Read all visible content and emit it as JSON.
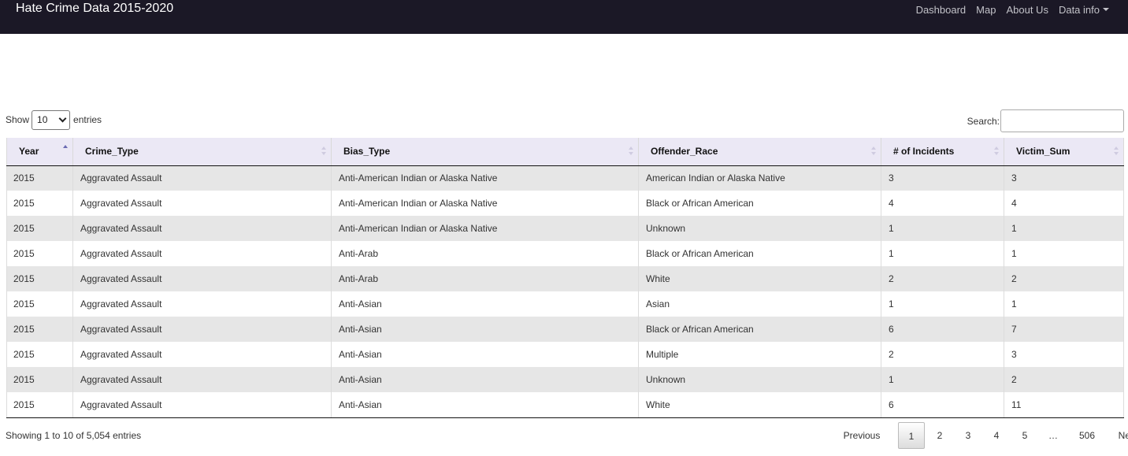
{
  "navbar": {
    "brand": "Hate Crime Data 2015-2020",
    "links": [
      "Dashboard",
      "Map",
      "About Us",
      "Data info"
    ]
  },
  "length_control": {
    "prefix": "Show",
    "value": "10",
    "suffix": "entries"
  },
  "search": {
    "label": "Search:",
    "value": ""
  },
  "table": {
    "columns": [
      "Year",
      "Crime_Type",
      "Bias_Type",
      "Offender_Race",
      "# of Incidents",
      "Victim_Sum"
    ],
    "sorted_column": "Year",
    "rows": [
      [
        "2015",
        "Aggravated Assault",
        "Anti-American Indian or Alaska Native",
        "American Indian or Alaska Native",
        "3",
        "3"
      ],
      [
        "2015",
        "Aggravated Assault",
        "Anti-American Indian or Alaska Native",
        "Black or African American",
        "4",
        "4"
      ],
      [
        "2015",
        "Aggravated Assault",
        "Anti-American Indian or Alaska Native",
        "Unknown",
        "1",
        "1"
      ],
      [
        "2015",
        "Aggravated Assault",
        "Anti-Arab",
        "Black or African American",
        "1",
        "1"
      ],
      [
        "2015",
        "Aggravated Assault",
        "Anti-Arab",
        "White",
        "2",
        "2"
      ],
      [
        "2015",
        "Aggravated Assault",
        "Anti-Asian",
        "Asian",
        "1",
        "1"
      ],
      [
        "2015",
        "Aggravated Assault",
        "Anti-Asian",
        "Black or African American",
        "6",
        "7"
      ],
      [
        "2015",
        "Aggravated Assault",
        "Anti-Asian",
        "Multiple",
        "2",
        "3"
      ],
      [
        "2015",
        "Aggravated Assault",
        "Anti-Asian",
        "Unknown",
        "1",
        "2"
      ],
      [
        "2015",
        "Aggravated Assault",
        "Anti-Asian",
        "White",
        "6",
        "11"
      ]
    ]
  },
  "info": "Showing 1 to 10 of 5,054 entries",
  "pagination": {
    "previous": "Previous",
    "pages": [
      "1",
      "2",
      "3",
      "4",
      "5"
    ],
    "ellipsis": "…",
    "last": "506",
    "next": "Next",
    "current": "1"
  },
  "colors": {
    "navbar_bg": "#1b1826",
    "header_bg": "#ebe8f5",
    "odd_row_bg": "#e6e6e6"
  }
}
